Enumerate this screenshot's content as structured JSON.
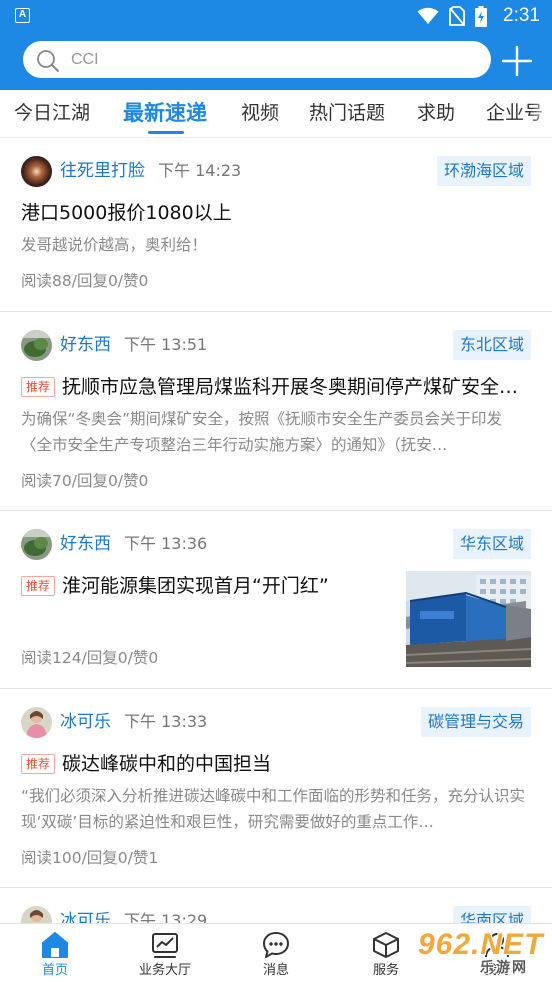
{
  "status_bar": {
    "time": "2:31",
    "app_badge": "A"
  },
  "search": {
    "placeholder": "CCI"
  },
  "tabs": [
    {
      "label": "今日江湖",
      "active": false
    },
    {
      "label": "最新速递",
      "active": true
    },
    {
      "label": "视频",
      "active": false
    },
    {
      "label": "热门话题",
      "active": false
    },
    {
      "label": "求助",
      "active": false
    },
    {
      "label": "企业号",
      "active": false
    }
  ],
  "posts": [
    {
      "author": "往死里打脸",
      "time": "下午 14:23",
      "region": "环渤海区域",
      "title": "港口5000报价1080以上",
      "summary": "发哥越说价越高，奥利给！",
      "stats": "阅读88/回复0/赞0"
    },
    {
      "author": "好东西",
      "time": "下午 13:51",
      "region": "东北区域",
      "badge": "推荐",
      "title": "抚顺市应急管理局煤监科开展冬奥期间停产煤矿安全…",
      "summary": "为确保“冬奥会”期间煤矿安全，按照《抚顺市安全生产委员会关于印发〈全市安全生产专项整治三年行动实施方案〉的通知》（抚安…",
      "stats": "阅读70/回复0/赞0"
    },
    {
      "author": "好东西",
      "time": "下午 13:36",
      "region": "华东区域",
      "badge": "推荐",
      "title": "淮河能源集团实现首月“开门红”",
      "stats": "阅读124/回复0/赞0"
    },
    {
      "author": "冰可乐",
      "time": "下午 13:33",
      "region": "碳管理与交易",
      "badge": "推荐",
      "title": "碳达峰碳中和的中国担当",
      "summary": "“我们必须深入分析推进碳达峰碳中和工作面临的形势和任务，充分认识实现‘双碳’目标的紧迫性和艰巨性，研究需要做好的重点工作…",
      "stats": "阅读100/回复0/赞1"
    },
    {
      "author": "冰可乐",
      "time": "下午 13:29",
      "region": "华南区域"
    }
  ],
  "bottom_nav": [
    {
      "label": "首页",
      "icon": "home-icon",
      "active": true
    },
    {
      "label": "业务大厅",
      "icon": "chart-icon",
      "active": false
    },
    {
      "label": "消息",
      "icon": "chat-icon",
      "active": false
    },
    {
      "label": "服务",
      "icon": "box-icon",
      "active": false
    },
    {
      "label": "我的",
      "icon": "user-icon",
      "active": false
    }
  ],
  "watermark": {
    "brand": "962.NET",
    "subtitle": "乐游网"
  },
  "colors": {
    "primary": "#1e88e5",
    "tag_bg": "#e9f3fd",
    "badge_red": "#e2513c"
  }
}
